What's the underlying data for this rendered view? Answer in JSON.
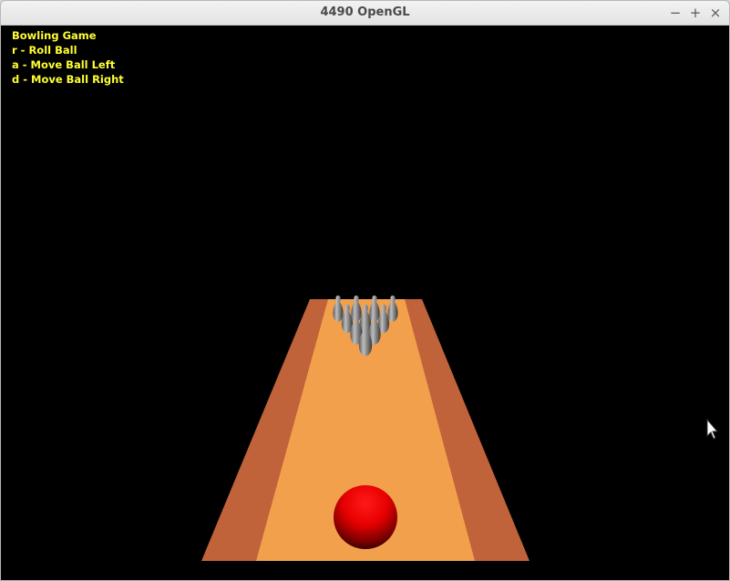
{
  "window": {
    "title": "4490 OpenGL",
    "controls": {
      "minimize": "−",
      "maximize": "+",
      "close": "×"
    }
  },
  "hud": {
    "title": "Bowling Game",
    "lines": [
      "r - Roll Ball",
      "a - Move Ball Left",
      "d - Move Ball Right"
    ]
  },
  "scene": {
    "background_color": "#000000",
    "hud_text_color": "#ffff33",
    "lane_color": "#f2a04c",
    "gutter_color": "#c0623a",
    "ball_color": "#ff0000",
    "pin_color": "#8c8c8c",
    "pin_count": 10
  }
}
